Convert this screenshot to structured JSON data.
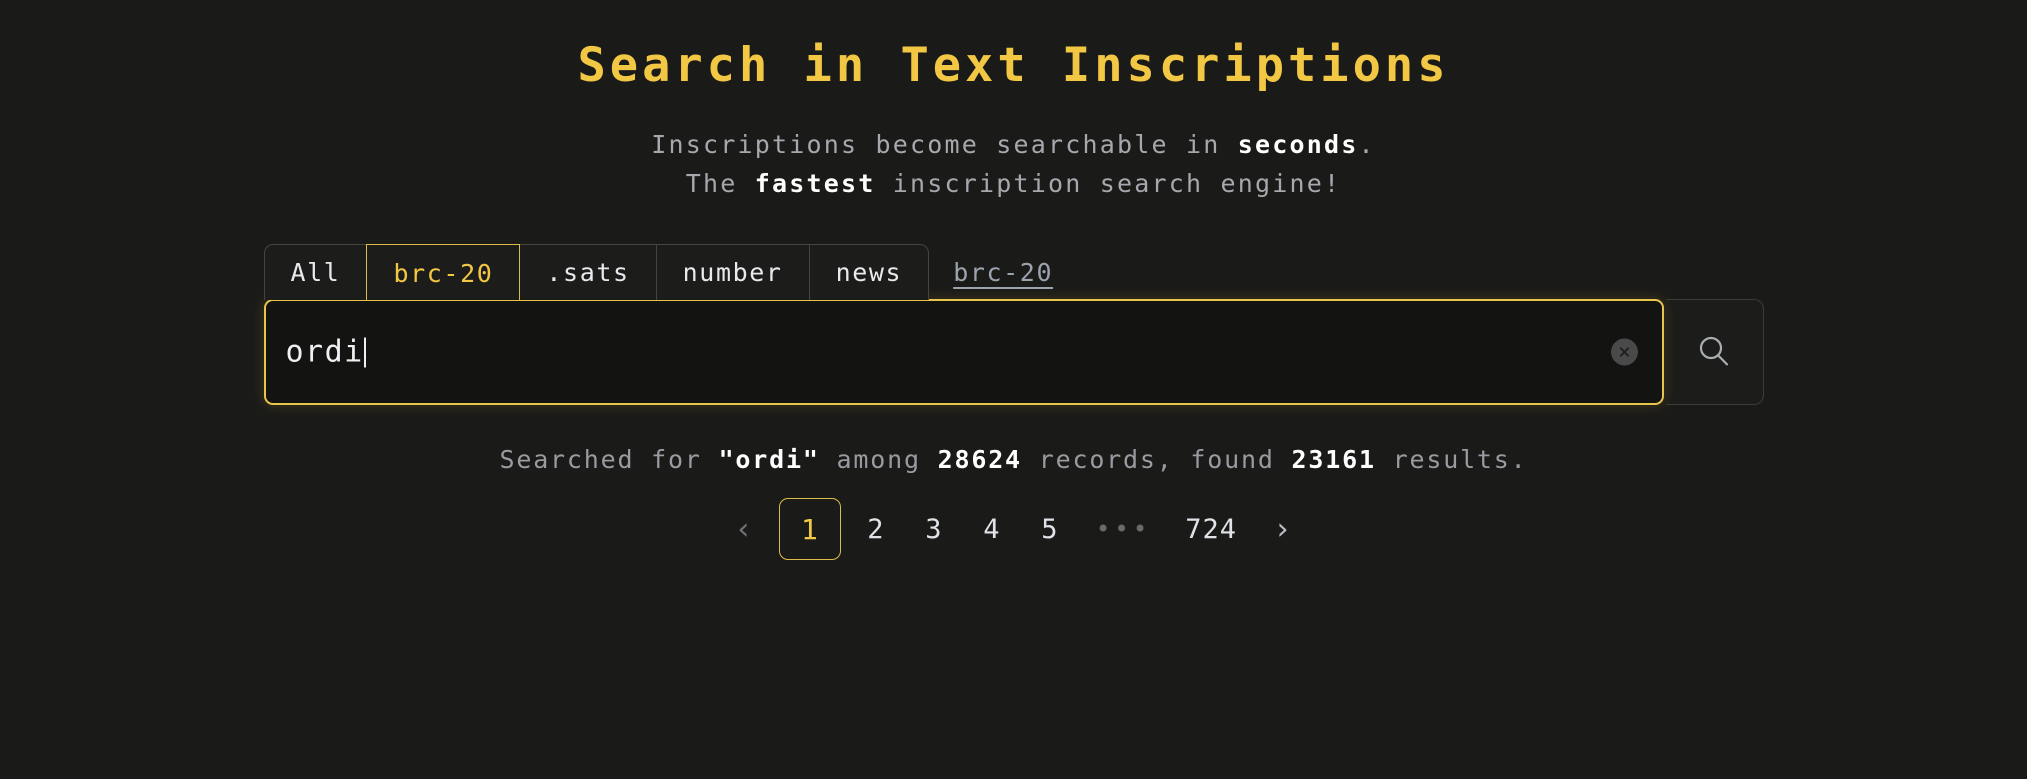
{
  "theme": {
    "background": "#1a1a18",
    "accent_gold": "#f2c744",
    "border_gold": "#e8c44a",
    "muted_text": "#9a9aa1",
    "bright_text": "#ffffff"
  },
  "header": {
    "title": "Search in Text Inscriptions",
    "subtitle_line1_pre": "Inscriptions become searchable in ",
    "subtitle_line1_strong": "seconds",
    "subtitle_line1_post": ".",
    "subtitle_line2_pre": "The ",
    "subtitle_line2_strong": "fastest",
    "subtitle_line2_post": " inscription search engine!"
  },
  "filters": {
    "tabs": [
      {
        "label": "All",
        "active": false
      },
      {
        "label": "brc-20",
        "active": true
      },
      {
        "label": ".sats",
        "active": false
      },
      {
        "label": "number",
        "active": false
      },
      {
        "label": "news",
        "active": false
      }
    ],
    "active_link_label": "brc-20"
  },
  "search": {
    "value": "ordi",
    "placeholder": "",
    "clear_icon": "circle-x-icon",
    "search_icon": "magnifier-icon"
  },
  "results": {
    "prefix": "Searched for ",
    "query": "\"ordi\"",
    "middle1": " among ",
    "record_count": "28624",
    "middle2": " records, found ",
    "found_count": "23161",
    "suffix": " results."
  },
  "pagination": {
    "prev_label": "‹",
    "next_label": "›",
    "ellipsis_label": "•••",
    "pages": [
      "1",
      "2",
      "3",
      "4",
      "5"
    ],
    "last_page": "724",
    "current_page": "1"
  }
}
